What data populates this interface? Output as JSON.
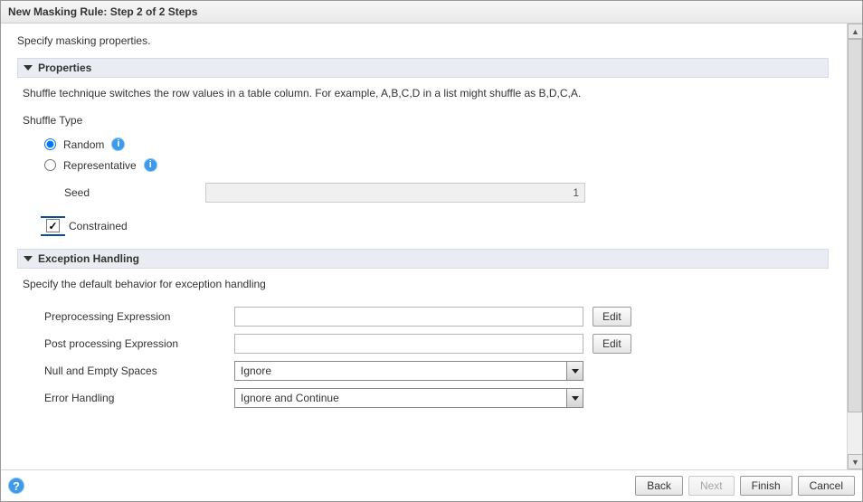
{
  "window": {
    "title": "New Masking Rule: Step 2 of 2 Steps"
  },
  "intro": "Specify masking properties.",
  "properties": {
    "header": "Properties",
    "description": "Shuffle technique switches the row values in a table column. For example, A,B,C,D in a list might shuffle as B,D,C,A.",
    "shuffle_type_label": "Shuffle Type",
    "options": {
      "random": {
        "label": "Random",
        "selected": true
      },
      "representative": {
        "label": "Representative",
        "selected": false
      }
    },
    "seed": {
      "label": "Seed",
      "value": "1"
    },
    "constrained": {
      "label": "Constrained",
      "checked": true
    }
  },
  "exception": {
    "header": "Exception Handling",
    "intro": "Specify the default behavior for exception handling",
    "preprocessing": {
      "label": "Preprocessing Expression",
      "value": "",
      "edit": "Edit"
    },
    "postprocessing": {
      "label": "Post processing Expression",
      "value": "",
      "edit": "Edit"
    },
    "null_empty": {
      "label": "Null and Empty Spaces",
      "value": "Ignore"
    },
    "error_handling": {
      "label": "Error Handling",
      "value": "Ignore and Continue"
    }
  },
  "footer": {
    "back": "Back",
    "next": "Next",
    "finish": "Finish",
    "cancel": "Cancel"
  }
}
